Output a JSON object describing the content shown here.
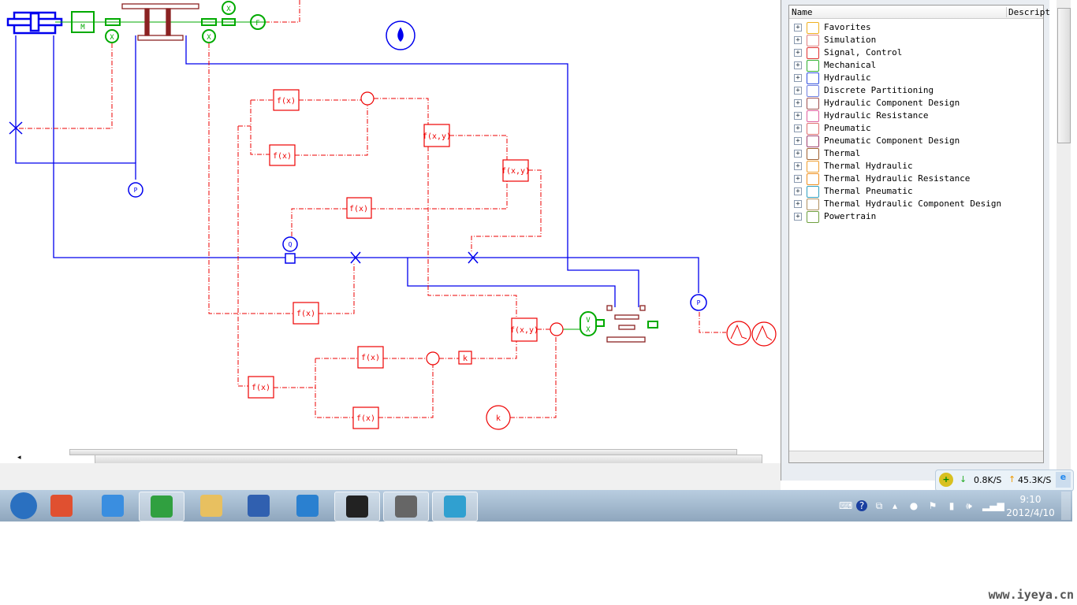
{
  "diagram": {
    "blocks": {
      "mass": "M",
      "force": "F",
      "disp1": "X",
      "disp2": "X",
      "disp3": "X",
      "vx_v": "V",
      "vx_x": "X",
      "fx1": "f(x)",
      "fx2": "f(x)",
      "fx3": "f(x)",
      "fx4": "f(x)",
      "fx5": "f(x)",
      "fx6": "f(x)",
      "fx7": "f(x)",
      "fxy1": "f(x,y)",
      "fxy2": "f(x,y)",
      "fxy3": "f(x,y)",
      "gain": "k",
      "const_k": "k",
      "pressure1": "P",
      "pressure2": "P",
      "flow": "Q"
    },
    "colors": {
      "hydraulic": "#0000ee",
      "signal": "#ee0000",
      "mechanical": "#00aa00",
      "component": "#8b2222"
    }
  },
  "library": {
    "columns": {
      "name": "Name",
      "description": "Descript"
    },
    "items": [
      {
        "label": "Favorites",
        "color": "#f0b020"
      },
      {
        "label": "Simulation",
        "color": "#e08080"
      },
      {
        "label": "Signal, Control",
        "color": "#e03030"
      },
      {
        "label": "Mechanical",
        "color": "#30b030"
      },
      {
        "label": "Hydraulic",
        "color": "#3050e0"
      },
      {
        "label": "Discrete Partitioning",
        "color": "#7080e0"
      },
      {
        "label": "Hydraulic Component Design",
        "color": "#a05050"
      },
      {
        "label": "Hydraulic Resistance",
        "color": "#e060a0"
      },
      {
        "label": "Pneumatic",
        "color": "#e07070"
      },
      {
        "label": "Pneumatic Component Design",
        "color": "#a04070"
      },
      {
        "label": "Thermal",
        "color": "#a06030"
      },
      {
        "label": "Thermal Hydraulic",
        "color": "#f0a030"
      },
      {
        "label": "Thermal Hydraulic Resistance",
        "color": "#f09020"
      },
      {
        "label": "Thermal Pneumatic",
        "color": "#30a0c0"
      },
      {
        "label": "Thermal Hydraulic Component Design",
        "color": "#b09060"
      },
      {
        "label": "Powertrain",
        "color": "#70a040"
      }
    ]
  },
  "netmon": {
    "down": "0.8K/S",
    "up": "45.3K/S"
  },
  "taskbar": {
    "apps": [
      {
        "name": "start",
        "color": "#2a70c0"
      },
      {
        "name": "windows-live",
        "color": "#e05030"
      },
      {
        "name": "internet-explorer",
        "color": "#3a8ee0"
      },
      {
        "name": "browser-green",
        "color": "#30a040"
      },
      {
        "name": "explorer",
        "color": "#e8c060"
      },
      {
        "name": "media",
        "color": "#3060b0"
      },
      {
        "name": "bird",
        "color": "#2a80d0"
      },
      {
        "name": "qq",
        "color": "#222"
      },
      {
        "name": "amesim",
        "color": "#666"
      },
      {
        "name": "installer",
        "color": "#30a0d0"
      }
    ],
    "time": "9:10",
    "date": "2012/4/10"
  },
  "watermark": "www.iyeya.cn"
}
